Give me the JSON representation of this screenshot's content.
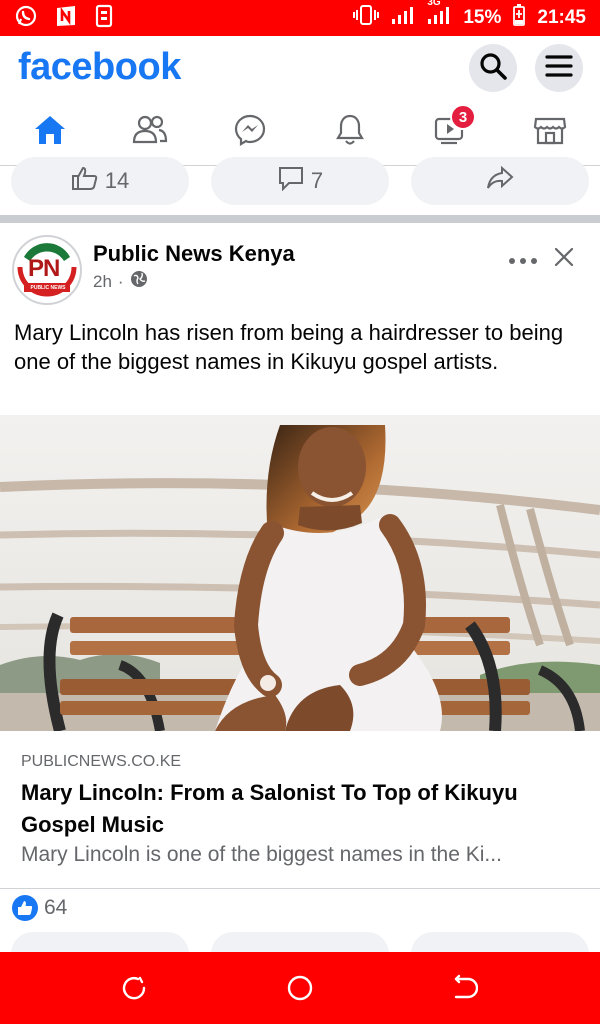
{
  "status_bar": {
    "battery": "15%",
    "time": "21:45",
    "network": "3G",
    "icons": [
      "whatsapp-icon",
      "n-app-icon",
      "sim-icon",
      "vibrate-icon",
      "signal-icon",
      "signal-3g-icon",
      "battery-charging-icon"
    ]
  },
  "header": {
    "logo": "facebook",
    "search_icon": "search-icon",
    "menu_icon": "menu-icon"
  },
  "nav": {
    "items": [
      {
        "name": "home",
        "icon": "home-icon",
        "active": true
      },
      {
        "name": "friends",
        "icon": "friends-icon"
      },
      {
        "name": "messenger",
        "icon": "messenger-icon"
      },
      {
        "name": "notifications",
        "icon": "bell-icon"
      },
      {
        "name": "watch",
        "icon": "video-icon",
        "badge": "3"
      },
      {
        "name": "marketplace",
        "icon": "store-icon"
      }
    ]
  },
  "previous_post": {
    "like_count": "14",
    "comment_count": "7"
  },
  "post": {
    "author": "Public News Kenya",
    "time": "2h",
    "separator": "·",
    "avatar_text": "PN",
    "avatar_subtext": "PUBLIC NEWS",
    "text": "Mary Lincoln has risen from being a hairdresser to being one of the biggest names in Kikuyu gospel artists.",
    "link": {
      "domain": "PUBLICNEWS.CO.KE",
      "headline": "Mary Lincoln: From a Salonist To Top of Kikuyu Gospel Music",
      "description": "Mary Lincoln is one of the biggest names in the Ki..."
    },
    "reactions_count": "64"
  },
  "colors": {
    "status_bar": "#ff0000",
    "brand": "#1877f2",
    "badge": "#e41e3f"
  }
}
